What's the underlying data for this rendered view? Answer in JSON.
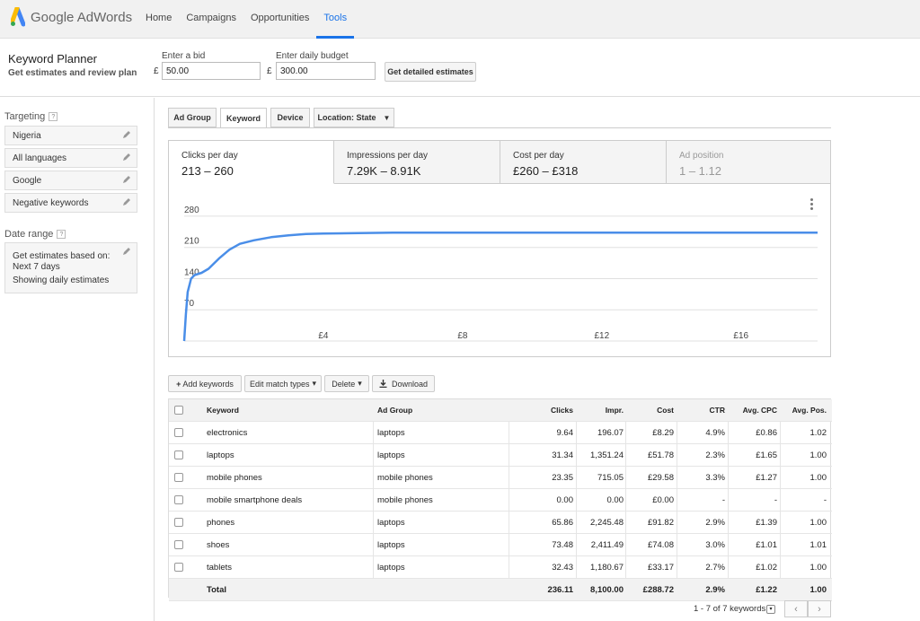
{
  "app": {
    "brand": "Google",
    "product": "AdWords"
  },
  "nav": [
    {
      "label": "Home",
      "active": false
    },
    {
      "label": "Campaigns",
      "active": false
    },
    {
      "label": "Opportunities",
      "active": false
    },
    {
      "label": "Tools",
      "active": true
    }
  ],
  "header": {
    "title": "Keyword Planner",
    "subtitle": "Get estimates and review plan",
    "bid": {
      "label": "Enter a bid",
      "currency": "£",
      "value": "50.00"
    },
    "budget": {
      "label": "Enter daily budget",
      "currency": "£",
      "value": "300.00"
    },
    "estimates_button": "Get detailed estimates"
  },
  "sidebar": {
    "targeting_label": "Targeting",
    "help": "?",
    "targeting_items": [
      "Nigeria",
      "All languages",
      "Google",
      "Negative keywords"
    ],
    "date_range_label": "Date range",
    "date_lines": [
      "Get estimates based on:",
      "Next 7 days",
      "Showing daily estimates"
    ]
  },
  "tabs": [
    {
      "label": "Ad Group",
      "active": false
    },
    {
      "label": "Keyword",
      "active": true
    },
    {
      "label": "Device",
      "active": false
    },
    {
      "label": "Location: State",
      "active": false,
      "dropdown": "▼"
    }
  ],
  "metrics": [
    {
      "label": "Clicks per day",
      "value": "213 – 260",
      "state": "active"
    },
    {
      "label": "Impressions per day",
      "value": "7.29K – 8.91K",
      "state": "normal"
    },
    {
      "label": "Cost per day",
      "value": "£260 – £318",
      "state": "normal"
    },
    {
      "label": "Ad position",
      "value": "1 – 1.12",
      "state": "disabled"
    }
  ],
  "colors": {
    "accent": "#1a73e8",
    "line": "#4a8ee8"
  },
  "chart_data": {
    "type": "line",
    "xlabel": "",
    "ylabel": "",
    "x_tick_labels": [
      "£4",
      "£8",
      "£12",
      "£16"
    ],
    "x_ticks": [
      4,
      8,
      12,
      16
    ],
    "y_ticks": [
      70,
      140,
      210,
      280
    ],
    "xlim": [
      0,
      18.2
    ],
    "ylim": [
      0,
      300
    ],
    "grid": true,
    "series": [
      {
        "x": [
          0,
          0.05,
          0.1,
          0.2,
          0.3,
          0.5,
          0.7,
          1.0,
          1.3,
          1.6,
          2.0,
          2.5,
          3.0,
          3.5,
          4,
          5,
          6,
          7,
          8,
          10,
          12,
          14,
          16,
          18.2
        ],
        "y": [
          0,
          60,
          110,
          140,
          148,
          153,
          162,
          185,
          205,
          218,
          226,
          233,
          237,
          240,
          241,
          242,
          243,
          243,
          243,
          243,
          243,
          243,
          243,
          243
        ]
      }
    ]
  },
  "toolbar": {
    "add": "Add keywords",
    "add_icon": "+",
    "edit": "Edit match types",
    "delete": "Delete",
    "caret": "▾",
    "download": "Download"
  },
  "table": {
    "columns": [
      "Keyword",
      "Ad Group",
      "Clicks",
      "Impr.",
      "Cost",
      "CTR",
      "Avg. CPC",
      "Avg. Pos."
    ],
    "rows": [
      [
        "electronics",
        "laptops",
        "9.64",
        "196.07",
        "£8.29",
        "4.9%",
        "£0.86",
        "1.02"
      ],
      [
        "laptops",
        "laptops",
        "31.34",
        "1,351.24",
        "£51.78",
        "2.3%",
        "£1.65",
        "1.00"
      ],
      [
        "mobile phones",
        "mobile phones",
        "23.35",
        "715.05",
        "£29.58",
        "3.3%",
        "£1.27",
        "1.00"
      ],
      [
        "mobile smartphone deals",
        "mobile phones",
        "0.00",
        "0.00",
        "£0.00",
        "-",
        "-",
        "-"
      ],
      [
        "phones",
        "laptops",
        "65.86",
        "2,245.48",
        "£91.82",
        "2.9%",
        "£1.39",
        "1.00"
      ],
      [
        "shoes",
        "laptops",
        "73.48",
        "2,411.49",
        "£74.08",
        "3.0%",
        "£1.01",
        "1.01"
      ],
      [
        "tablets",
        "laptops",
        "32.43",
        "1,180.67",
        "£33.17",
        "2.7%",
        "£1.02",
        "1.00"
      ]
    ],
    "total": [
      "Total",
      "",
      "236.11",
      "8,100.00",
      "£288.72",
      "2.9%",
      "£1.22",
      "1.00"
    ]
  },
  "pager": {
    "text": "1 - 7 of 7 keywords",
    "dropdown": "▾",
    "prev": "‹",
    "next": "›"
  }
}
